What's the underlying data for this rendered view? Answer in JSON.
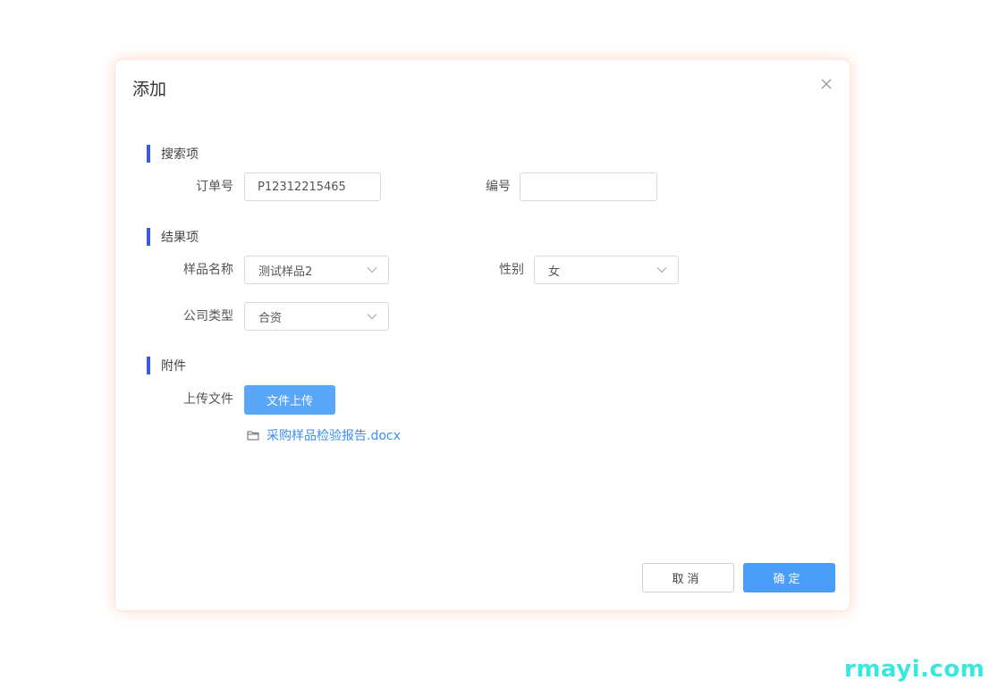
{
  "dialog": {
    "title": "添加",
    "close_icon": "close-icon"
  },
  "search_section": {
    "title": "搜索项",
    "order_no": {
      "label": "订单号",
      "value": "P12312215465"
    },
    "code": {
      "label": "编号",
      "value": ""
    }
  },
  "result_section": {
    "title": "结果项",
    "sample_name": {
      "label": "样品名称",
      "value": "测试样品2"
    },
    "gender": {
      "label": "性别",
      "value": "女"
    },
    "company_type": {
      "label": "公司类型",
      "value": "合资"
    }
  },
  "attachment_section": {
    "title": "附件",
    "upload": {
      "label": "上传文件",
      "button_label": "文件上传"
    },
    "files": [
      {
        "name": "采购样品检验报告.docx",
        "icon": "folder-icon"
      }
    ]
  },
  "footer": {
    "cancel_label": "取消",
    "ok_label": "确定"
  },
  "watermark": "rmayi.com",
  "colors": {
    "accent_bar": "#3a5be0",
    "primary": "#4a9df8",
    "upload": "#5aa7f8",
    "link": "#3a8ff0",
    "watermark": "#35e8e0"
  }
}
